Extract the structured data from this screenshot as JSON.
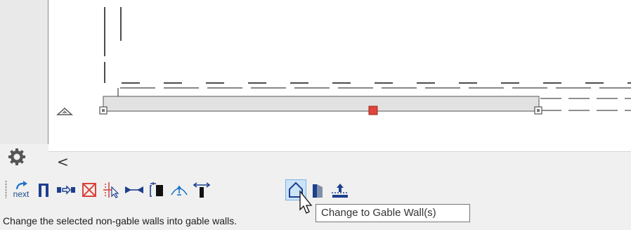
{
  "status_bar": {
    "text": "Change the selected non-gable walls into gable walls."
  },
  "tooltip": {
    "text": "Change to Gable Wall(s)"
  },
  "toolbar": {
    "next_label": "next",
    "active_tool": "change-to-gable-wall-button"
  },
  "scrollbar": {
    "left_arrow": "<"
  },
  "colors": {
    "wall_fill": "#e2e2e2",
    "wall_stroke": "#6e6e6e",
    "selected_handle": "#e0443a",
    "toolbar_icon_blue": "#1d3f8f",
    "active_tool_bg": "#cce4f7"
  }
}
